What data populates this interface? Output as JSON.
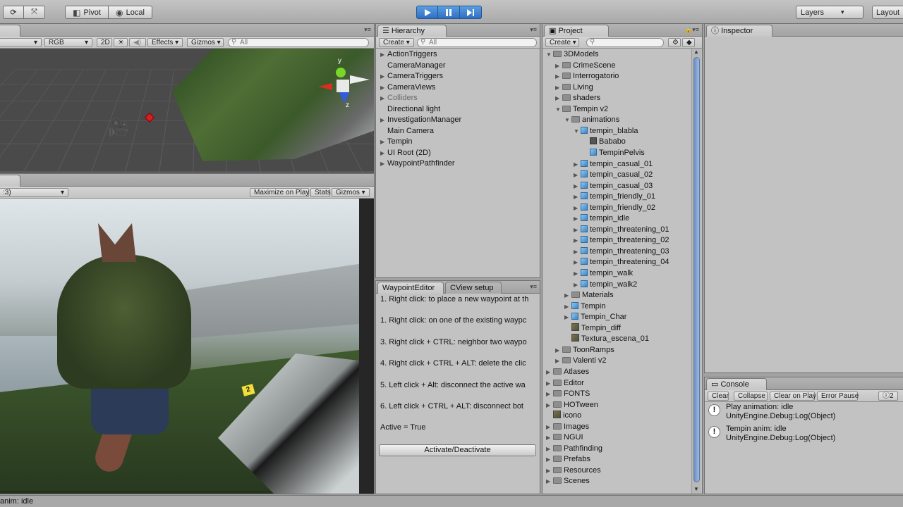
{
  "toolbar": {
    "pivot_label": "Pivot",
    "local_label": "Local",
    "layers_label": "Layers",
    "layout_label": "Layout"
  },
  "scene": {
    "mode_label": "RGB",
    "twod_label": "2D",
    "effects_label": "Effects",
    "gizmos_label": "Gizmos",
    "search_placeholder": "All",
    "axis_y": "y",
    "axis_z": "z"
  },
  "game": {
    "aspect_label": ":3)",
    "maximize_label": "Maximize on Play",
    "stats_label": "Stats",
    "gizmos_label": "Gizmos"
  },
  "hierarchy": {
    "tab_label": "Hierarchy",
    "create_label": "Create",
    "search_placeholder": "All",
    "items": [
      {
        "label": "ActionTriggers",
        "expandable": true,
        "dim": false
      },
      {
        "label": "CameraManager",
        "expandable": false,
        "dim": false
      },
      {
        "label": "CameraTriggers",
        "expandable": true,
        "dim": false
      },
      {
        "label": "CameraViews",
        "expandable": true,
        "dim": false
      },
      {
        "label": "Colliders",
        "expandable": true,
        "dim": true
      },
      {
        "label": "Directional light",
        "expandable": false,
        "dim": false
      },
      {
        "label": "InvestigationManager",
        "expandable": true,
        "dim": false
      },
      {
        "label": "Main Camera",
        "expandable": false,
        "dim": false
      },
      {
        "label": "Tempin",
        "expandable": true,
        "dim": false
      },
      {
        "label": "UI Root (2D)",
        "expandable": true,
        "dim": false
      },
      {
        "label": "WaypointPathfinder",
        "expandable": true,
        "dim": false
      }
    ]
  },
  "waypoint_editor": {
    "tab_label": "WaypointEditor",
    "tab2_label": "CView setup",
    "lines": [
      "1. Right click: to place a new waypoint at th",
      "1. Right click: on one of the existing waypc",
      "3. Right click + CTRL: neighbor two waypo",
      "4. Right click + CTRL + ALT: delete the clic",
      "5. Left click + Alt: disconnect the active wa",
      "6. Left click + CTRL + ALT: disconnect bot",
      "Active = True"
    ],
    "button_label": "Activate/Deactivate"
  },
  "project": {
    "tab_label": "Project",
    "create_label": "Create",
    "items": [
      {
        "label": "3DModels",
        "depth": 0,
        "arrow": "open",
        "icon": "folder"
      },
      {
        "label": "CrimeScene",
        "depth": 1,
        "arrow": "closed",
        "icon": "folder"
      },
      {
        "label": "Interrogatorio",
        "depth": 1,
        "arrow": "closed",
        "icon": "folder"
      },
      {
        "label": "Living",
        "depth": 1,
        "arrow": "closed",
        "icon": "folder"
      },
      {
        "label": "shaders",
        "depth": 1,
        "arrow": "closed",
        "icon": "folder"
      },
      {
        "label": "Tempin v2",
        "depth": 1,
        "arrow": "open",
        "icon": "folder"
      },
      {
        "label": "animations",
        "depth": 2,
        "arrow": "open",
        "icon": "folder"
      },
      {
        "label": "tempin_blabla",
        "depth": 3,
        "arrow": "open",
        "icon": "cube"
      },
      {
        "label": "Bababo",
        "depth": 4,
        "arrow": "none",
        "icon": "anim"
      },
      {
        "label": "TempinPelvis",
        "depth": 4,
        "arrow": "none",
        "icon": "cube"
      },
      {
        "label": "tempin_casual_01",
        "depth": 3,
        "arrow": "closed",
        "icon": "cube"
      },
      {
        "label": "tempin_casual_02",
        "depth": 3,
        "arrow": "closed",
        "icon": "cube"
      },
      {
        "label": "tempin_casual_03",
        "depth": 3,
        "arrow": "closed",
        "icon": "cube"
      },
      {
        "label": "tempin_friendly_01",
        "depth": 3,
        "arrow": "closed",
        "icon": "cube"
      },
      {
        "label": "tempin_friendly_02",
        "depth": 3,
        "arrow": "closed",
        "icon": "cube"
      },
      {
        "label": "tempin_idle",
        "depth": 3,
        "arrow": "closed",
        "icon": "cube"
      },
      {
        "label": "tempin_threatening_01",
        "depth": 3,
        "arrow": "closed",
        "icon": "cube"
      },
      {
        "label": "tempin_threatening_02",
        "depth": 3,
        "arrow": "closed",
        "icon": "cube"
      },
      {
        "label": "tempin_threatening_03",
        "depth": 3,
        "arrow": "closed",
        "icon": "cube"
      },
      {
        "label": "tempin_threatening_04",
        "depth": 3,
        "arrow": "closed",
        "icon": "cube"
      },
      {
        "label": "tempin_walk",
        "depth": 3,
        "arrow": "closed",
        "icon": "cube"
      },
      {
        "label": "tempin_walk2",
        "depth": 3,
        "arrow": "closed",
        "icon": "cube"
      },
      {
        "label": "Materials",
        "depth": 2,
        "arrow": "closed",
        "icon": "folder"
      },
      {
        "label": "Tempin",
        "depth": 2,
        "arrow": "closed",
        "icon": "cube"
      },
      {
        "label": "Tempin_Char",
        "depth": 2,
        "arrow": "closed",
        "icon": "cube"
      },
      {
        "label": "Tempin_diff",
        "depth": 2,
        "arrow": "none",
        "icon": "image"
      },
      {
        "label": "Textura_escena_01",
        "depth": 2,
        "arrow": "none",
        "icon": "image"
      },
      {
        "label": "ToonRamps",
        "depth": 1,
        "arrow": "closed",
        "icon": "folder"
      },
      {
        "label": "Valenti v2",
        "depth": 1,
        "arrow": "closed",
        "icon": "folder"
      },
      {
        "label": "Atlases",
        "depth": 0,
        "arrow": "closed",
        "icon": "folder"
      },
      {
        "label": "Editor",
        "depth": 0,
        "arrow": "closed",
        "icon": "folder"
      },
      {
        "label": "FONTS",
        "depth": 0,
        "arrow": "closed",
        "icon": "folder"
      },
      {
        "label": "HOTween",
        "depth": 0,
        "arrow": "closed",
        "icon": "folder"
      },
      {
        "label": "icono",
        "depth": 0,
        "arrow": "none",
        "icon": "image"
      },
      {
        "label": "Images",
        "depth": 0,
        "arrow": "closed",
        "icon": "folder"
      },
      {
        "label": "NGUI",
        "depth": 0,
        "arrow": "closed",
        "icon": "folder"
      },
      {
        "label": "Pathfinding",
        "depth": 0,
        "arrow": "closed",
        "icon": "folder"
      },
      {
        "label": "Prefabs",
        "depth": 0,
        "arrow": "closed",
        "icon": "folder"
      },
      {
        "label": "Resources",
        "depth": 0,
        "arrow": "closed",
        "icon": "folder"
      },
      {
        "label": "Scenes",
        "depth": 0,
        "arrow": "closed",
        "icon": "folder"
      }
    ]
  },
  "inspector": {
    "tab_label": "Inspector"
  },
  "console": {
    "tab_label": "Console",
    "clear_label": "Clear",
    "collapse_label": "Collapse",
    "clear_on_play_label": "Clear on Play",
    "error_pause_label": "Error Pause",
    "count_label": "2",
    "entries": [
      {
        "line1": "Play animation: idle",
        "line2": "UnityEngine.Debug:Log(Object)"
      },
      {
        "line1": "Tempin anim: idle",
        "line2": "UnityEngine.Debug:Log(Object)"
      }
    ]
  },
  "status": {
    "text": "anim: idle"
  }
}
